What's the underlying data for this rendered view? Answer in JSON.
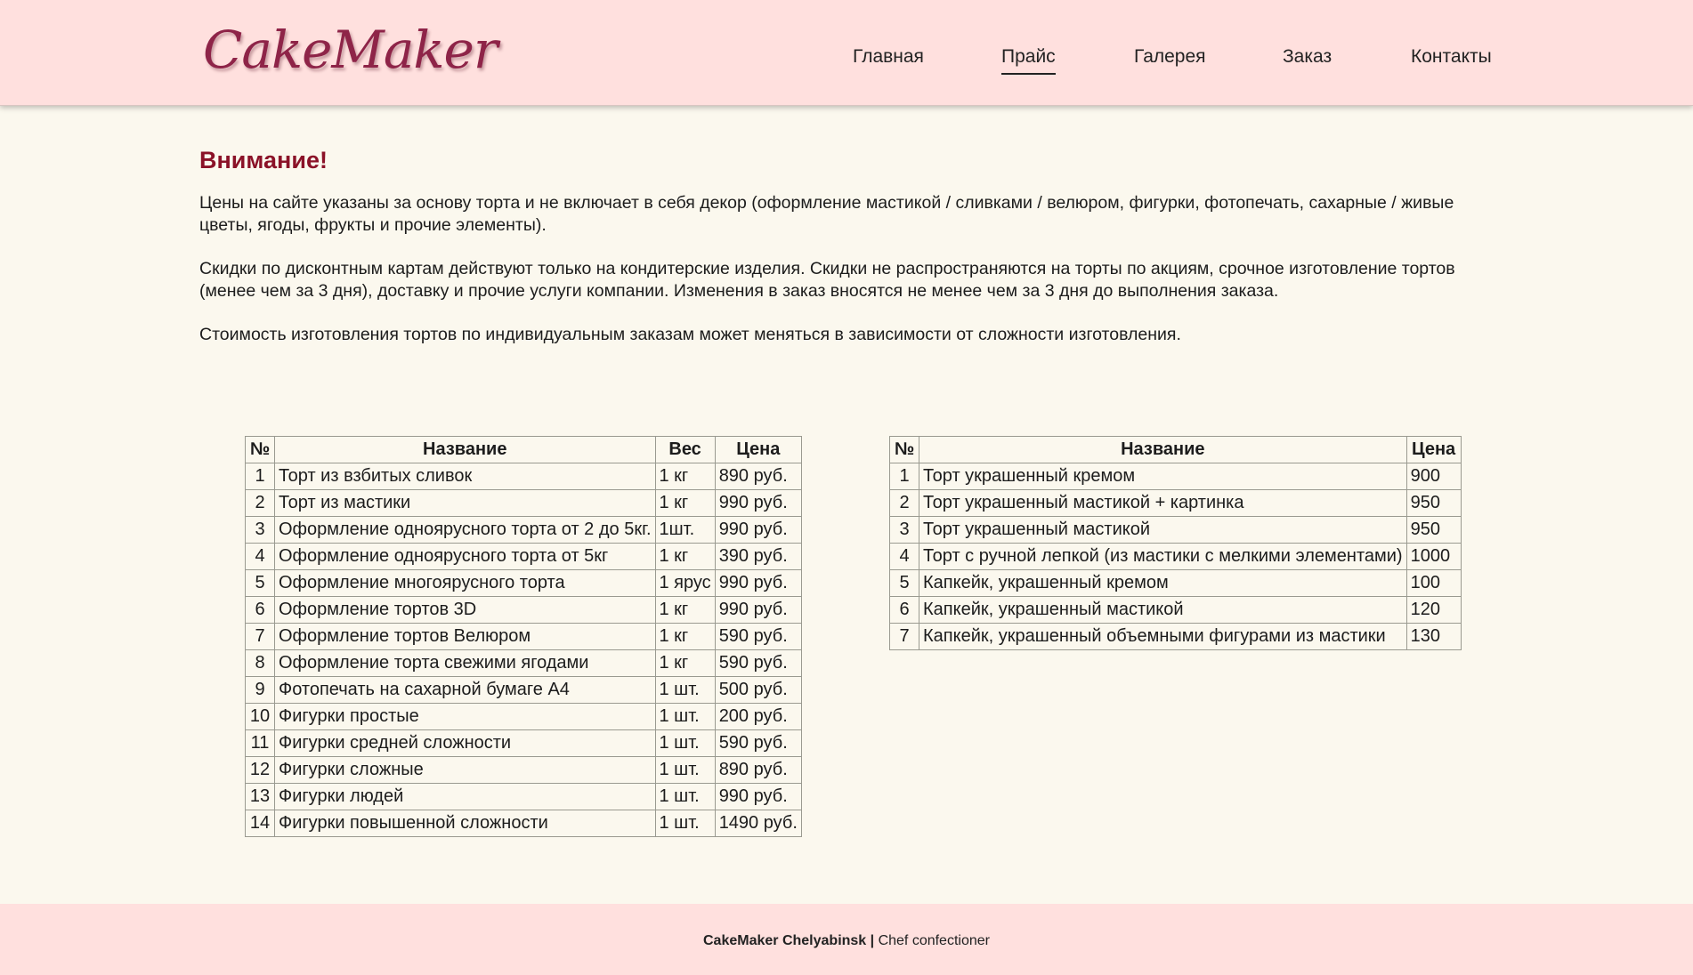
{
  "brand": {
    "logo_text": "CakeMaker"
  },
  "nav": {
    "items": [
      {
        "label": "Главная"
      },
      {
        "label": "Прайс"
      },
      {
        "label": "Галерея"
      },
      {
        "label": "Заказ"
      },
      {
        "label": "Контакты"
      }
    ],
    "active": "Прайс"
  },
  "notice": {
    "title": "Внимание!",
    "paragraphs": [
      "Цены на сайте указаны за основу торта и не включает в себя декор (оформление мастикой / сливками / велюром, фигурки, фотопечать, сахарные / живые цветы, ягоды, фрукты и прочие элементы).",
      "Скидки по дисконтным картам действуют только на кондитерские изделия. Скидки не распространяются на торты по акциям, срочное изготовление тортов (менее чем за 3 дня), доставку и прочие услуги компании. Изменения в заказ вносятся не менее чем за 3 дня до выполнения заказа.",
      "Стоимость изготовления тортов по индивидуальным заказам может меняться в зависимости от сложности изготовления."
    ]
  },
  "table_left": {
    "headers": [
      "№",
      "Название",
      "Вес",
      "Цена"
    ],
    "rows": [
      [
        "1",
        "Торт из взбитых сливок",
        "1 кг",
        "890 руб."
      ],
      [
        "2",
        "Торт из мастики",
        "1 кг",
        "990 руб."
      ],
      [
        "3",
        "Оформление одноярусного торта от 2 до 5кг.",
        "1шт.",
        "990 руб."
      ],
      [
        "4",
        "Оформление одноярусного торта от 5кг",
        "1 кг",
        "390 руб."
      ],
      [
        "5",
        "Оформление многоярусного торта",
        "1 ярус",
        "990 руб."
      ],
      [
        "6",
        "Оформление тортов 3D",
        "1 кг",
        "990 руб."
      ],
      [
        "7",
        "Оформление тортов Велюром",
        "1 кг",
        "590 руб."
      ],
      [
        "8",
        "Оформление торта свежими ягодами",
        "1 кг",
        "590 руб."
      ],
      [
        "9",
        "Фотопечать на сахарной бумаге А4",
        "1 шт.",
        "500 руб."
      ],
      [
        "10",
        "Фигурки простые",
        "1 шт.",
        "200 руб."
      ],
      [
        "11",
        "Фигурки средней сложности",
        "1 шт.",
        "590 руб."
      ],
      [
        "12",
        "Фигурки сложные",
        "1 шт.",
        "890 руб."
      ],
      [
        "13",
        "Фигурки людей",
        "1 шт.",
        "990 руб."
      ],
      [
        "14",
        "Фигурки повышенной сложности",
        "1 шт.",
        "1490 руб."
      ]
    ]
  },
  "table_right": {
    "headers": [
      "№",
      "Название",
      "Цена"
    ],
    "rows": [
      [
        "1",
        "Торт украшенный кремом",
        "900"
      ],
      [
        "2",
        "Торт украшенный мастикой + картинка",
        "950"
      ],
      [
        "3",
        "Торт украшенный мастикой",
        "950"
      ],
      [
        "4",
        "Торт с ручной лепкой (из мастики с мелкими элементами)",
        "1000"
      ],
      [
        "5",
        "Капкейк, украшенный кремом",
        "100"
      ],
      [
        "6",
        "Капкейк, украшенный мастикой",
        "120"
      ],
      [
        "7",
        "Капкейк, украшенный объемными фигурами из мастики",
        "130"
      ]
    ]
  },
  "footer": {
    "brand": "CakeMaker Chelyabinsk |",
    "tagline": " Chef confectioner"
  },
  "colors": {
    "header_bg": "#ffe0de",
    "page_bg": "#fbf8ee",
    "logo": "#8e2448",
    "warning_title": "#8b1228"
  }
}
